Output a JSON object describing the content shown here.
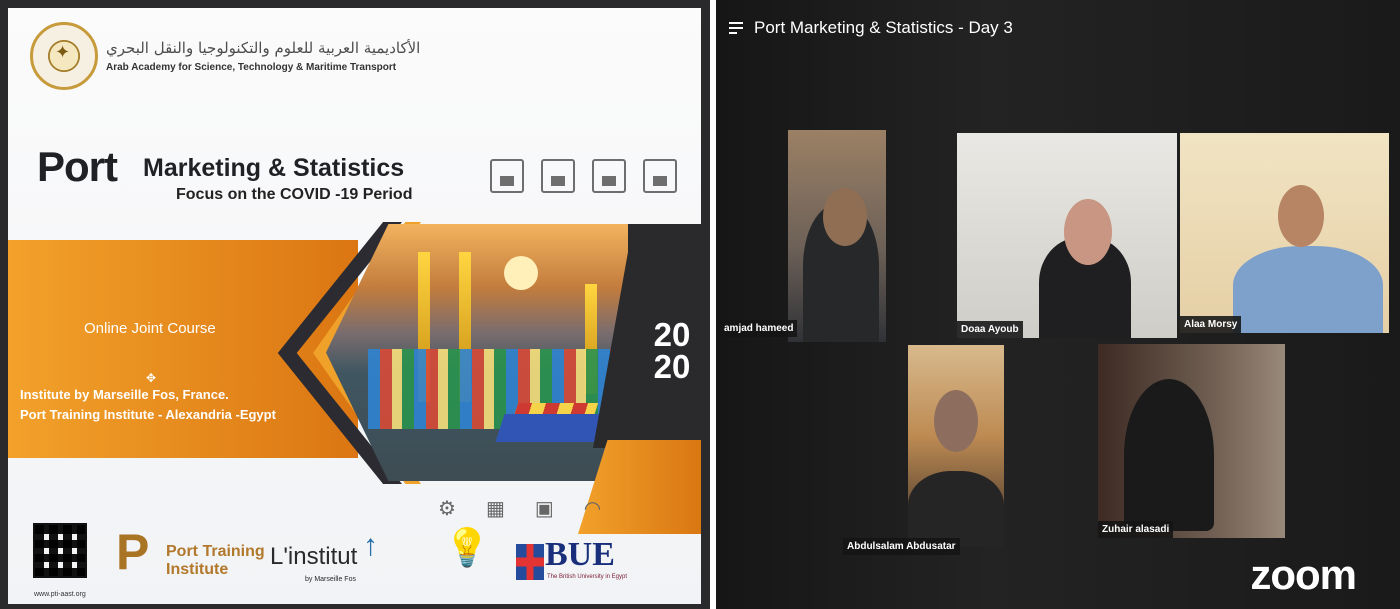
{
  "slide": {
    "academy_arabic": "الأكاديمية العربية للعلوم والتكنولوجيا والنقل البحري",
    "academy_english": "Arab Academy for Science, Technology & Maritime Transport",
    "title_port": "Port",
    "title_rest": "Marketing & Statistics",
    "subtitle": "Focus on the COVID -19 Period",
    "course_type": "Online Joint Course",
    "institute_line_1": "Institute by Marseille Fos, France.",
    "institute_line_2": "Port Training Institute - Alexandria -Egypt",
    "year_top": "20",
    "year_bottom": "20",
    "qr_url": "www.pti-aast.org",
    "port_training_line_1": "Port Training",
    "port_training_line_2": "Institute",
    "linstitut_name": "L'institut",
    "linstitut_sub": "by Marseille Fos",
    "bue_name": "BUE",
    "bue_sub": "The British University in Egypt"
  },
  "zoom": {
    "meeting_title": "Port Marketing & Statistics - Day 3",
    "participants": [
      {
        "name": "amjad hameed"
      },
      {
        "name": "Doaa Ayoub"
      },
      {
        "name": "Alaa Morsy"
      },
      {
        "name": "Abdulsalam Abdusatar"
      },
      {
        "name": "Zuhair alasadi"
      }
    ],
    "brand": "zoom"
  },
  "colors": {
    "slide_orange": "#E8951F",
    "slide_dark": "#2B2B31",
    "zoom_background": "#1F1F1F",
    "text_white": "#FFFFFF"
  }
}
